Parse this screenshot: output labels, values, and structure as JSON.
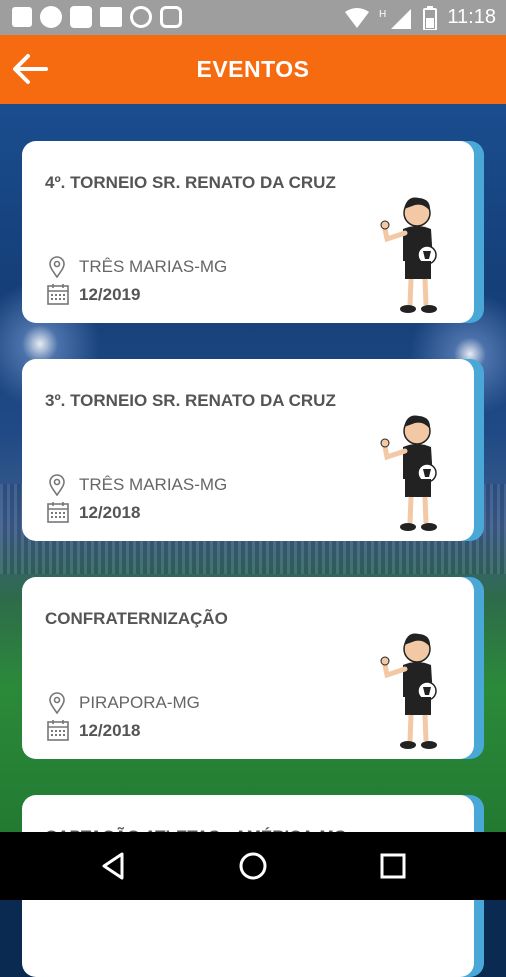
{
  "status_bar": {
    "time": "11:18",
    "left_icons": [
      "notification-icon",
      "circle-icon",
      "square-icon",
      "image-icon",
      "whatsapp-icon",
      "instagram-icon"
    ],
    "right_icons": [
      "wifi-icon",
      "signal-icon",
      "battery-icon"
    ]
  },
  "app_bar": {
    "title": "EVENTOS",
    "back_icon": "arrow-left-icon",
    "color": "#f76b10"
  },
  "events": [
    {
      "name": "4º. TORNEIO SR. RENATO DA CRUZ",
      "city": "TRÊS MARIAS-MG",
      "date": "12/2019"
    },
    {
      "name": "3º. TORNEIO SR. RENATO DA CRUZ",
      "city": "TRÊS MARIAS-MG",
      "date": "12/2018"
    },
    {
      "name": "CONFRATERNIZAÇÃO",
      "city": "PIRAPORA-MG",
      "date": "12/2018"
    },
    {
      "name": "CAPTAÇÃO ATLETAS - AMÉRICA-MG",
      "city": "",
      "date": ""
    }
  ],
  "nav_bar": {
    "back_icon": "triangle-back-icon",
    "home_icon": "circle-home-icon",
    "recents_icon": "square-recents-icon"
  }
}
